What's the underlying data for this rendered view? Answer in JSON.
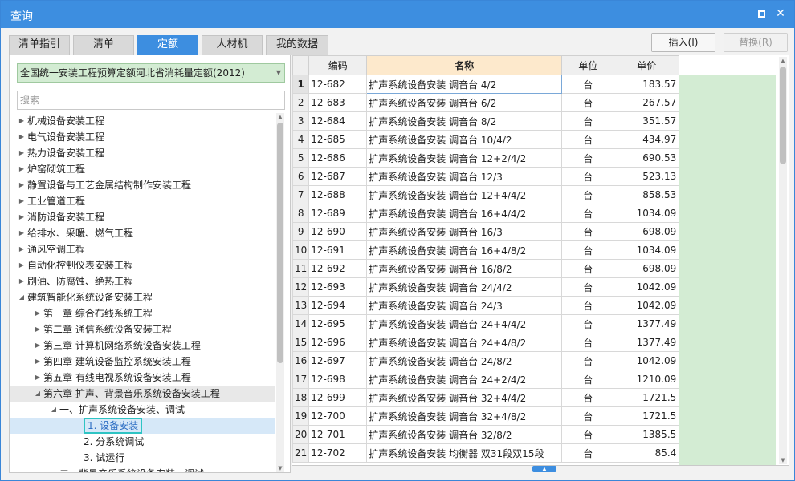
{
  "window": {
    "title": "查询"
  },
  "tabs": [
    {
      "label": "清单指引"
    },
    {
      "label": "清单"
    },
    {
      "label": "定额",
      "active": true
    },
    {
      "label": "人材机"
    },
    {
      "label": "我的数据"
    }
  ],
  "actions": {
    "insert_label": "插入(I)",
    "replace_label": "替换(R)"
  },
  "left": {
    "quota_library_selected": "全国统一安装工程预算定额河北省消耗量定额(2012)",
    "search_placeholder": "搜索",
    "tree": [
      {
        "label": "机械设备安装工程",
        "level": 0,
        "toggle": "collapsed"
      },
      {
        "label": "电气设备安装工程",
        "level": 0,
        "toggle": "collapsed"
      },
      {
        "label": "热力设备安装工程",
        "level": 0,
        "toggle": "collapsed"
      },
      {
        "label": "炉窑砌筑工程",
        "level": 0,
        "toggle": "collapsed"
      },
      {
        "label": "静置设备与工艺金属结构制作安装工程",
        "level": 0,
        "toggle": "collapsed"
      },
      {
        "label": "工业管道工程",
        "level": 0,
        "toggle": "collapsed"
      },
      {
        "label": "消防设备安装工程",
        "level": 0,
        "toggle": "collapsed"
      },
      {
        "label": "给排水、采暖、燃气工程",
        "level": 0,
        "toggle": "collapsed"
      },
      {
        "label": "通风空调工程",
        "level": 0,
        "toggle": "collapsed"
      },
      {
        "label": "自动化控制仪表安装工程",
        "level": 0,
        "toggle": "collapsed"
      },
      {
        "label": "刷油、防腐蚀、绝热工程",
        "level": 0,
        "toggle": "collapsed"
      },
      {
        "label": "建筑智能化系统设备安装工程",
        "level": 0,
        "toggle": "expanded"
      },
      {
        "label": "第一章 综合布线系统工程",
        "level": 1,
        "toggle": "collapsed"
      },
      {
        "label": "第二章 通信系统设备安装工程",
        "level": 1,
        "toggle": "collapsed"
      },
      {
        "label": "第三章 计算机网络系统设备安装工程",
        "level": 1,
        "toggle": "collapsed"
      },
      {
        "label": "第四章 建筑设备监控系统安装工程",
        "level": 1,
        "toggle": "collapsed"
      },
      {
        "label": "第五章 有线电视系统设备安装工程",
        "level": 1,
        "toggle": "collapsed"
      },
      {
        "label": "第六章 扩声、背景音乐系统设备安装工程",
        "level": 1,
        "toggle": "expanded",
        "highlight": true
      },
      {
        "label": "一、扩声系统设备安装、调试",
        "level": 2,
        "toggle": "expanded"
      },
      {
        "label": "1. 设备安装",
        "level": 3,
        "toggle": "none",
        "selected": true
      },
      {
        "label": "2. 分系统调试",
        "level": 3,
        "toggle": "none"
      },
      {
        "label": "3. 试运行",
        "level": 3,
        "toggle": "none"
      },
      {
        "label": "二、背景音乐系统设备安装、调试",
        "level": 2,
        "toggle": "none"
      }
    ]
  },
  "grid": {
    "columns": [
      "编码",
      "名称",
      "单位",
      "单价"
    ],
    "active_column": 1,
    "current_row": 1,
    "rows": [
      {
        "n": "1",
        "code": "12-682",
        "name": "扩声系统设备安装 调音台 4/2",
        "unit": "台",
        "price": "183.57"
      },
      {
        "n": "2",
        "code": "12-683",
        "name": "扩声系统设备安装 调音台 6/2",
        "unit": "台",
        "price": "267.57"
      },
      {
        "n": "3",
        "code": "12-684",
        "name": "扩声系统设备安装 调音台 8/2",
        "unit": "台",
        "price": "351.57"
      },
      {
        "n": "4",
        "code": "12-685",
        "name": "扩声系统设备安装 调音台 10/4/2",
        "unit": "台",
        "price": "434.97"
      },
      {
        "n": "5",
        "code": "12-686",
        "name": "扩声系统设备安装 调音台 12+2/4/2",
        "unit": "台",
        "price": "690.53"
      },
      {
        "n": "6",
        "code": "12-687",
        "name": "扩声系统设备安装 调音台 12/3",
        "unit": "台",
        "price": "523.13"
      },
      {
        "n": "7",
        "code": "12-688",
        "name": "扩声系统设备安装 调音台 12+4/4/2",
        "unit": "台",
        "price": "858.53"
      },
      {
        "n": "8",
        "code": "12-689",
        "name": "扩声系统设备安装 调音台 16+4/4/2",
        "unit": "台",
        "price": "1034.09"
      },
      {
        "n": "9",
        "code": "12-690",
        "name": "扩声系统设备安装 调音台 16/3",
        "unit": "台",
        "price": "698.09"
      },
      {
        "n": "10",
        "code": "12-691",
        "name": "扩声系统设备安装 调音台 16+4/8/2",
        "unit": "台",
        "price": "1034.09"
      },
      {
        "n": "11",
        "code": "12-692",
        "name": "扩声系统设备安装 调音台 16/8/2",
        "unit": "台",
        "price": "698.09"
      },
      {
        "n": "12",
        "code": "12-693",
        "name": "扩声系统设备安装 调音台 24/4/2",
        "unit": "台",
        "price": "1042.09"
      },
      {
        "n": "13",
        "code": "12-694",
        "name": "扩声系统设备安装 调音台 24/3",
        "unit": "台",
        "price": "1042.09"
      },
      {
        "n": "14",
        "code": "12-695",
        "name": "扩声系统设备安装 调音台 24+4/4/2",
        "unit": "台",
        "price": "1377.49"
      },
      {
        "n": "15",
        "code": "12-696",
        "name": "扩声系统设备安装 调音台 24+4/8/2",
        "unit": "台",
        "price": "1377.49"
      },
      {
        "n": "16",
        "code": "12-697",
        "name": "扩声系统设备安装 调音台 24/8/2",
        "unit": "台",
        "price": "1042.09"
      },
      {
        "n": "17",
        "code": "12-698",
        "name": "扩声系统设备安装 调音台 24+2/4/2",
        "unit": "台",
        "price": "1210.09"
      },
      {
        "n": "18",
        "code": "12-699",
        "name": "扩声系统设备安装 调音台 32+4/4/2",
        "unit": "台",
        "price": "1721.5"
      },
      {
        "n": "19",
        "code": "12-700",
        "name": "扩声系统设备安装 调音台 32+4/8/2",
        "unit": "台",
        "price": "1721.5"
      },
      {
        "n": "20",
        "code": "12-701",
        "name": "扩声系统设备安装 调音台 32/8/2",
        "unit": "台",
        "price": "1385.5"
      },
      {
        "n": "21",
        "code": "12-702",
        "name": "扩声系统设备安装 均衡器 双31段双15段",
        "unit": "台",
        "price": "85.4"
      }
    ]
  },
  "colors": {
    "titlebar": "#3d8ee0",
    "active_tab": "#3d8ee0",
    "library_select_bg": "#d3ecd3",
    "active_header": "#fde9cc",
    "tree_selection_border": "#2ec4c4"
  },
  "icons": {
    "maximize": "maximize-icon",
    "close": "close-icon",
    "dropdown": "chevron-down-icon",
    "expand": "triangle-right-icon",
    "collapse": "triangle-down-icon"
  }
}
